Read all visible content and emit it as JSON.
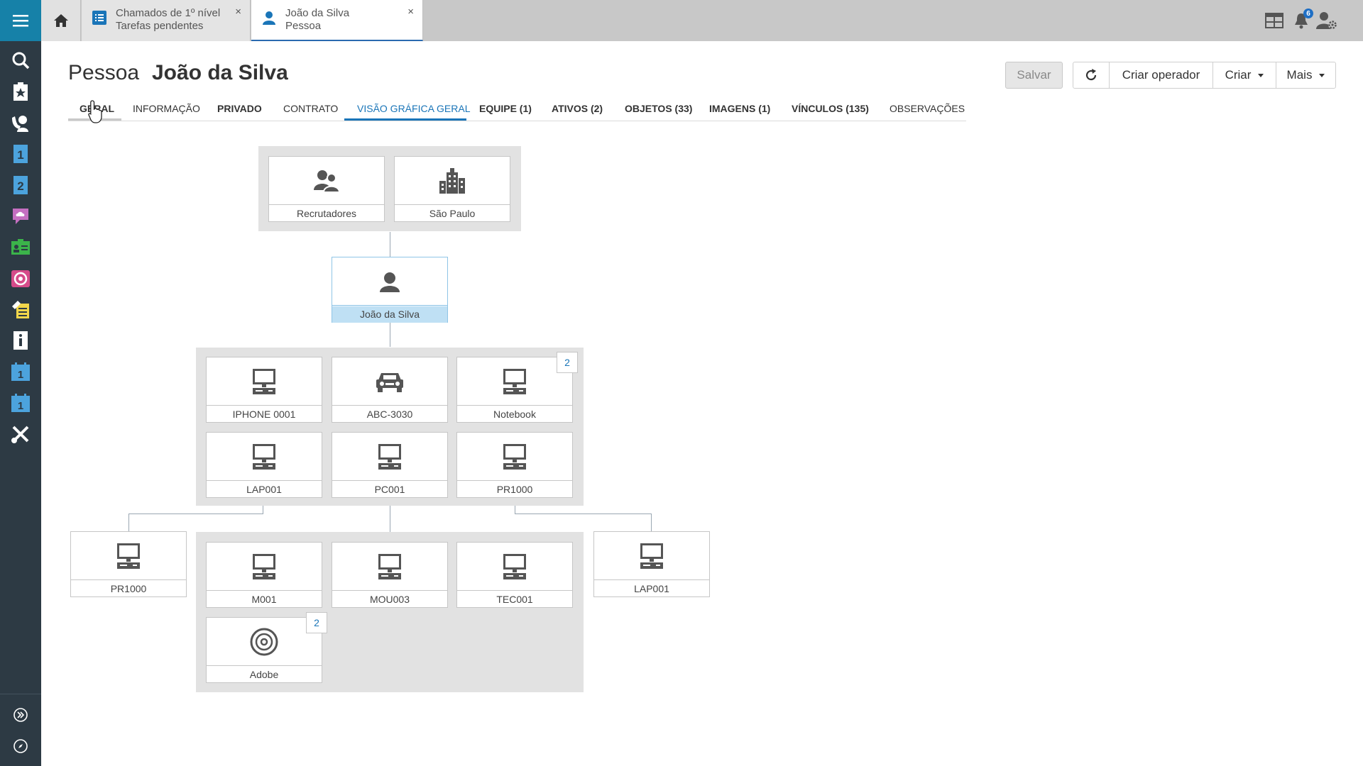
{
  "sidebar": {
    "items": [
      {
        "icon": "search-icon"
      },
      {
        "icon": "clipboard-star-icon"
      },
      {
        "icon": "phone-person-icon"
      },
      {
        "icon": "level-1-icon"
      },
      {
        "icon": "level-2-icon"
      },
      {
        "icon": "chat-cloud-icon"
      },
      {
        "icon": "contact-card-icon"
      },
      {
        "icon": "target-icon"
      },
      {
        "icon": "knowledge-icon"
      },
      {
        "icon": "info-book-icon"
      },
      {
        "icon": "calendar-1-icon"
      },
      {
        "icon": "calendar-1b-icon"
      },
      {
        "icon": "tools-icon"
      }
    ],
    "bottom": [
      {
        "icon": "expand-icon"
      },
      {
        "icon": "compass-icon"
      }
    ]
  },
  "tabs": [
    {
      "line1": "Chamados de 1º nível",
      "line2": "Tarefas pendentes",
      "icon": "list-icon"
    },
    {
      "line1": "João da Silva",
      "line2": "Pessoa",
      "icon": "person-icon"
    }
  ],
  "tab_close": "×",
  "notifications": {
    "count": "6"
  },
  "header": {
    "kind": "Pessoa",
    "name": "João da Silva"
  },
  "buttons": {
    "save": "Salvar",
    "create_operator": "Criar operador",
    "create": "Criar",
    "more": "Mais"
  },
  "navtabs": [
    {
      "label": "GERAL"
    },
    {
      "label": "INFORMAÇÃO"
    },
    {
      "label": "PRIVADO"
    },
    {
      "label": "CONTRATO"
    },
    {
      "label": "VISÃO GRÁFICA GERAL"
    },
    {
      "label": "EQUIPE (1)"
    },
    {
      "label": "ATIVOS (2)"
    },
    {
      "label": "OBJETOS (33)"
    },
    {
      "label": "IMAGENS (1)"
    },
    {
      "label": "VÍNCULOS (135)"
    },
    {
      "label": "OBSERVAÇÕES"
    }
  ],
  "diagram": {
    "top": [
      {
        "label": "Recrutadores",
        "icon": "group-icon"
      },
      {
        "label": "São Paulo",
        "icon": "building-icon"
      }
    ],
    "person": {
      "label": "João da Silva",
      "icon": "person-icon"
    },
    "assets": [
      {
        "label": "IPHONE 0001",
        "icon": "computer-icon"
      },
      {
        "label": "ABC-3030",
        "icon": "car-icon"
      },
      {
        "label": "Notebook",
        "icon": "computer-icon",
        "count": "2"
      },
      {
        "label": "LAP001",
        "icon": "computer-icon"
      },
      {
        "label": "PC001",
        "icon": "computer-icon"
      },
      {
        "label": "PR1000",
        "icon": "computer-icon"
      }
    ],
    "left": {
      "label": "PR1000",
      "icon": "computer-icon"
    },
    "right": {
      "label": "LAP001",
      "icon": "computer-icon"
    },
    "children": [
      {
        "label": "M001",
        "icon": "computer-icon"
      },
      {
        "label": "MOU003",
        "icon": "computer-icon"
      },
      {
        "label": "TEC001",
        "icon": "computer-icon"
      },
      {
        "label": "Adobe",
        "icon": "disc-icon",
        "count": "2"
      }
    ]
  },
  "colors": {
    "accent": "#1681a8",
    "rail": "#2d3a44",
    "selected_tab": "#1a75b8"
  }
}
